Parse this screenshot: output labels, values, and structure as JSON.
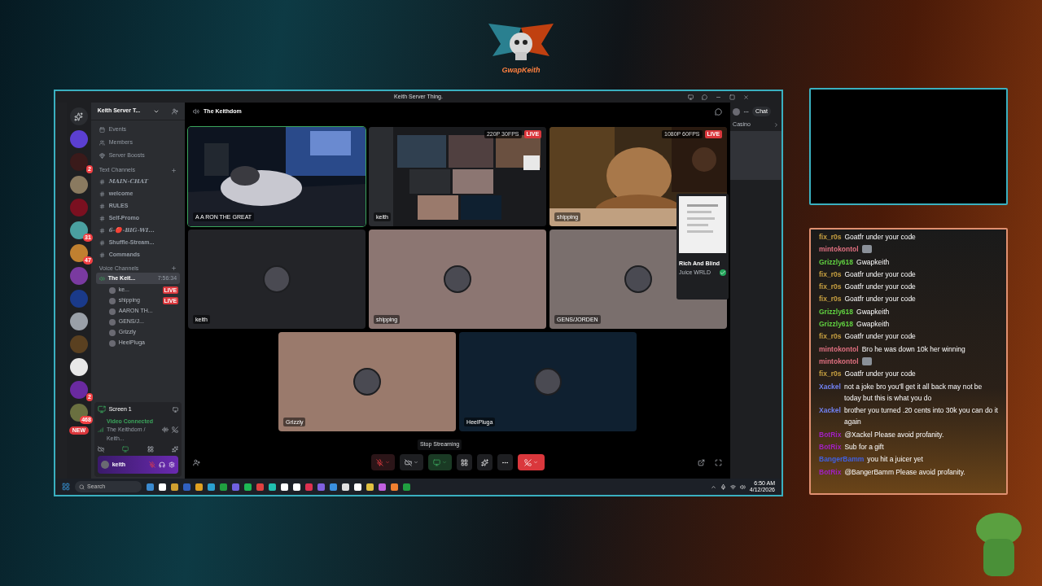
{
  "logo": {
    "text": "GwapKeith"
  },
  "window": {
    "title": "Keith Server Thing."
  },
  "servers": [
    {
      "color": "#5b3fd1"
    },
    {
      "color": "#3a1a1a",
      "badge": "2"
    },
    {
      "color": "#8a7a60"
    },
    {
      "color": "#7a1020"
    },
    {
      "color": "#4aa0a0",
      "badge": "31"
    },
    {
      "color": "#c08030",
      "badge": "47"
    },
    {
      "color": "#7a3aa0"
    },
    {
      "color": "#1a3a8a"
    },
    {
      "color": "#9aa0a8"
    },
    {
      "color": "#5a4020"
    },
    {
      "color": "#e8e8e8"
    },
    {
      "color": "#6a2aa0",
      "badge": "2"
    },
    {
      "color": "#6a7040",
      "badge": "468"
    }
  ],
  "rail_new": "NEW",
  "server": {
    "name": "Keith Server T...",
    "links": [
      "Events",
      "Members",
      "Server Boosts"
    ]
  },
  "text_category": "Text Channels",
  "text_channels": [
    {
      "name": "MAIN-CHAT",
      "italic": true
    },
    {
      "name": "welcome",
      "italic": false
    },
    {
      "name": "RULES",
      "italic": false
    },
    {
      "name": "Self-Promo",
      "italic": false
    },
    {
      "name": "6-🔴-BIG-WI...",
      "italic": true
    },
    {
      "name": "Shuffle-Stream...",
      "italic": false
    },
    {
      "name": "Commands",
      "italic": false
    }
  ],
  "voice_category": "Voice Channels",
  "voice_channel": {
    "name": "The Keit...",
    "time": "7:56:34",
    "selected": true
  },
  "voice_users": [
    {
      "name": "ke...",
      "badge": "LIVE"
    },
    {
      "name": "shipping",
      "badge": "LIVE"
    },
    {
      "name": "AARON TH..."
    },
    {
      "name": "GENS/J..."
    },
    {
      "name": "Grizzly"
    },
    {
      "name": "HeelPluga"
    }
  ],
  "stream_panel": {
    "title": "Screen 1",
    "status": "Video Connected",
    "location": "The Keithdom / Keith..."
  },
  "user": {
    "name": "keith",
    "mic_muted": true
  },
  "header": {
    "title": "The Keithdom"
  },
  "tiles": [
    {
      "kind": "video",
      "label": "A A RON THE GREAT",
      "color": "#111111"
    },
    {
      "kind": "video",
      "label": "keith",
      "quality": "220P 30FPS",
      "live": "LIVE",
      "color": "#111111"
    },
    {
      "kind": "video",
      "label": "shipping",
      "quality": "1080P 60FPS",
      "live": "LIVE",
      "color": "#111111"
    },
    {
      "kind": "avatar",
      "label": "keith",
      "color": "#232428"
    },
    {
      "kind": "avatar",
      "label": "shipping",
      "color": "#8c7672"
    },
    {
      "kind": "avatar",
      "label": "GENS/JORDEN",
      "color": "#7a6f6d"
    },
    {
      "kind": "avatar",
      "label": "Grizzly",
      "color": "#9a7a6c"
    },
    {
      "kind": "avatar",
      "label": "HeelPluga",
      "color": "#0f2030"
    }
  ],
  "tooltip": "Stop Streaming",
  "activity": {
    "chat": "Chat",
    "section": "Casino",
    "title": "Rich And Blind",
    "subtitle": "Juice WRLD"
  },
  "taskbar": {
    "search": "Search",
    "time": "6:50 AM",
    "date": "4/12/2026"
  },
  "chat": [
    {
      "kind": "text",
      "user": "fix_r0s",
      "color": "#c8a040",
      "text": "Goatfr under your code"
    },
    {
      "kind": "emote",
      "user": "mintokontol",
      "color": "#e07080"
    },
    {
      "kind": "text",
      "user": "Grizzly618",
      "color": "#60d040",
      "text": "Gwapkeith"
    },
    {
      "kind": "text",
      "user": "fix_r0s",
      "color": "#c8a040",
      "text": "Goatfr under your code"
    },
    {
      "kind": "text",
      "user": "fix_r0s",
      "color": "#c8a040",
      "text": "Goatfr under your code"
    },
    {
      "kind": "text",
      "user": "fix_r0s",
      "color": "#c8a040",
      "text": "Goatfr under your code"
    },
    {
      "kind": "text",
      "user": "Grizzly618",
      "color": "#60d040",
      "text": "Gwapkeith"
    },
    {
      "kind": "text",
      "user": "Grizzly618",
      "color": "#60d040",
      "text": "Gwapkeith"
    },
    {
      "kind": "text",
      "user": "fix_r0s",
      "color": "#c8a040",
      "text": "Goatfr under your code"
    },
    {
      "kind": "text",
      "user": "mintokontol",
      "color": "#e07080",
      "text": "Bro he was down 10k her winning"
    },
    {
      "kind": "emote",
      "user": "mintokontol",
      "color": "#e07080"
    },
    {
      "kind": "text",
      "user": "fix_r0s",
      "color": "#c8a040",
      "text": "Goatfr under your code"
    },
    {
      "kind": "text",
      "user": "Xackel",
      "color": "#7080f0",
      "text": "not a joke bro you'll get it all back may not be today but this is what you do"
    },
    {
      "kind": "text",
      "user": "Xackel",
      "color": "#7080f0",
      "text": "brother you turned .20 cents into 30k you can do it again"
    },
    {
      "kind": "text",
      "user": "BotRix",
      "color": "#a020c0",
      "text": "@Xackel Please avoid profanity."
    },
    {
      "kind": "text",
      "user": "BotRix",
      "color": "#a020c0",
      "text": "Sub for a gift"
    },
    {
      "kind": "text",
      "user": "BangerBamm",
      "color": "#4060e0",
      "text": "you hit a juicer yet"
    },
    {
      "kind": "text",
      "user": "BotRix",
      "color": "#a020c0",
      "text": "@BangerBamm Please avoid profanity."
    }
  ]
}
